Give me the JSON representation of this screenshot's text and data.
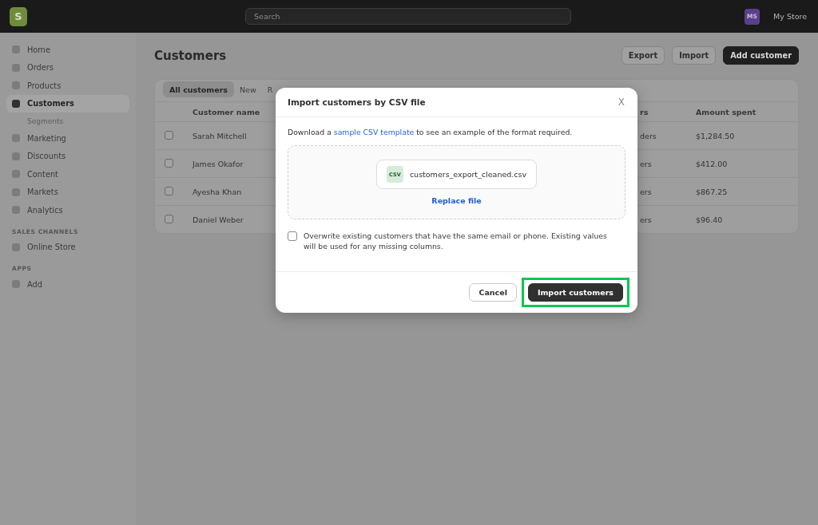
{
  "top_bar": {
    "logo": "S",
    "search": {
      "placeholder": "Search"
    },
    "avatar": "MS",
    "store_name": "My Store"
  },
  "sidebar": {
    "sections": [
      {
        "items": [
          {
            "label": "Home",
            "selected": false
          },
          {
            "label": "Orders",
            "selected": false
          },
          {
            "label": "Products",
            "selected": false
          },
          {
            "label": "Customers",
            "selected": true,
            "children": [
              {
                "label": "Segments",
                "selected": false
              }
            ]
          },
          {
            "label": "Marketing",
            "selected": false
          },
          {
            "label": "Discounts",
            "selected": false
          },
          {
            "label": "Content",
            "selected": false
          },
          {
            "label": "Markets",
            "selected": false
          },
          {
            "label": "Analytics",
            "selected": false
          }
        ]
      },
      {
        "heading": "SALES CHANNELS",
        "items": [
          {
            "label": "Online Store",
            "selected": false
          }
        ]
      },
      {
        "heading": "APPS",
        "items": [
          {
            "label": "Add",
            "selected": false
          }
        ]
      }
    ]
  },
  "page": {
    "title": "Customers",
    "actions": [
      {
        "label": "Export",
        "kind": "secondary"
      },
      {
        "label": "Import",
        "kind": "secondary"
      },
      {
        "label": "Add customer",
        "kind": "primary"
      }
    ]
  },
  "table": {
    "tabs": [
      {
        "label": "All customers",
        "selected": true
      },
      {
        "label": "New",
        "selected": false
      },
      {
        "label": "R",
        "selected": false
      }
    ],
    "columns": [
      "Customer name",
      "rs",
      "Amount spent"
    ],
    "rows": [
      {
        "checked": false,
        "cells": [
          "Sarah Mitchell",
          "ders",
          "$1,284.50"
        ]
      },
      {
        "checked": false,
        "cells": [
          "James Okafor",
          "ers",
          "$412.00"
        ]
      },
      {
        "checked": false,
        "cells": [
          "Ayesha Khan",
          "ers",
          "$867.25"
        ]
      },
      {
        "checked": false,
        "cells": [
          "Daniel Weber",
          "ers",
          "$96.40"
        ]
      }
    ]
  },
  "modal": {
    "title": "Import customers by CSV file",
    "close": "X",
    "description": {
      "before": "Download a ",
      "link": "sample CSV template",
      "after": " to see an example of the format required."
    },
    "file": {
      "badge": "CSV",
      "name": "customers_export_cleaned.csv"
    },
    "replace_link": "Replace file",
    "overwrite": {
      "label": "Overwrite existing customers that have the same email or phone. Existing values will be used for any missing columns.",
      "checked": false
    },
    "buttons": [
      {
        "label": "Cancel",
        "kind": "secondary",
        "highlighted": false
      },
      {
        "label": "Import customers",
        "kind": "primary",
        "highlighted": true
      }
    ]
  }
}
